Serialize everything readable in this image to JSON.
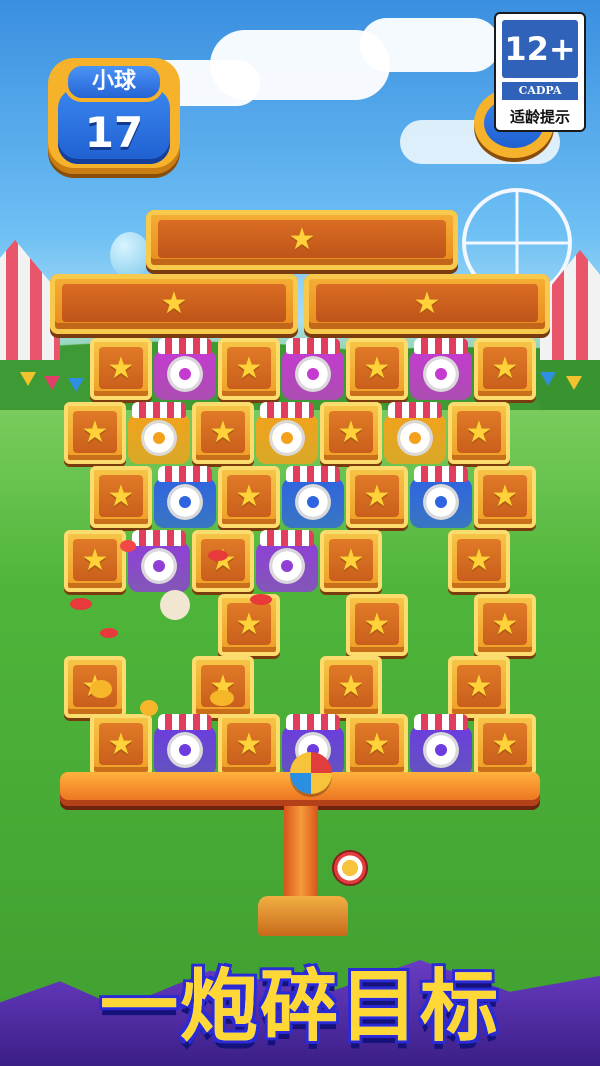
{
  "hud": {
    "balls_label": "小球",
    "balls_count": "17"
  },
  "age_rating": {
    "rating": "12+",
    "org": "CADPA",
    "tip": "适龄提示"
  },
  "board": {
    "star_glyph": "★",
    "jar_colors": {
      "grape": "#8f3fd6",
      "magenta": "#c53bd0",
      "orange": "#f2a21c",
      "blue": "#2f64e0",
      "purple": "#6b3de0"
    }
  },
  "slogan": "一炮碎目标",
  "colors": {
    "accent_gold": "#f5b22a",
    "hud_blue": "#1f5fd0",
    "slogan_yellow": "#ffd837",
    "slogan_outline": "#2b2bd6"
  }
}
